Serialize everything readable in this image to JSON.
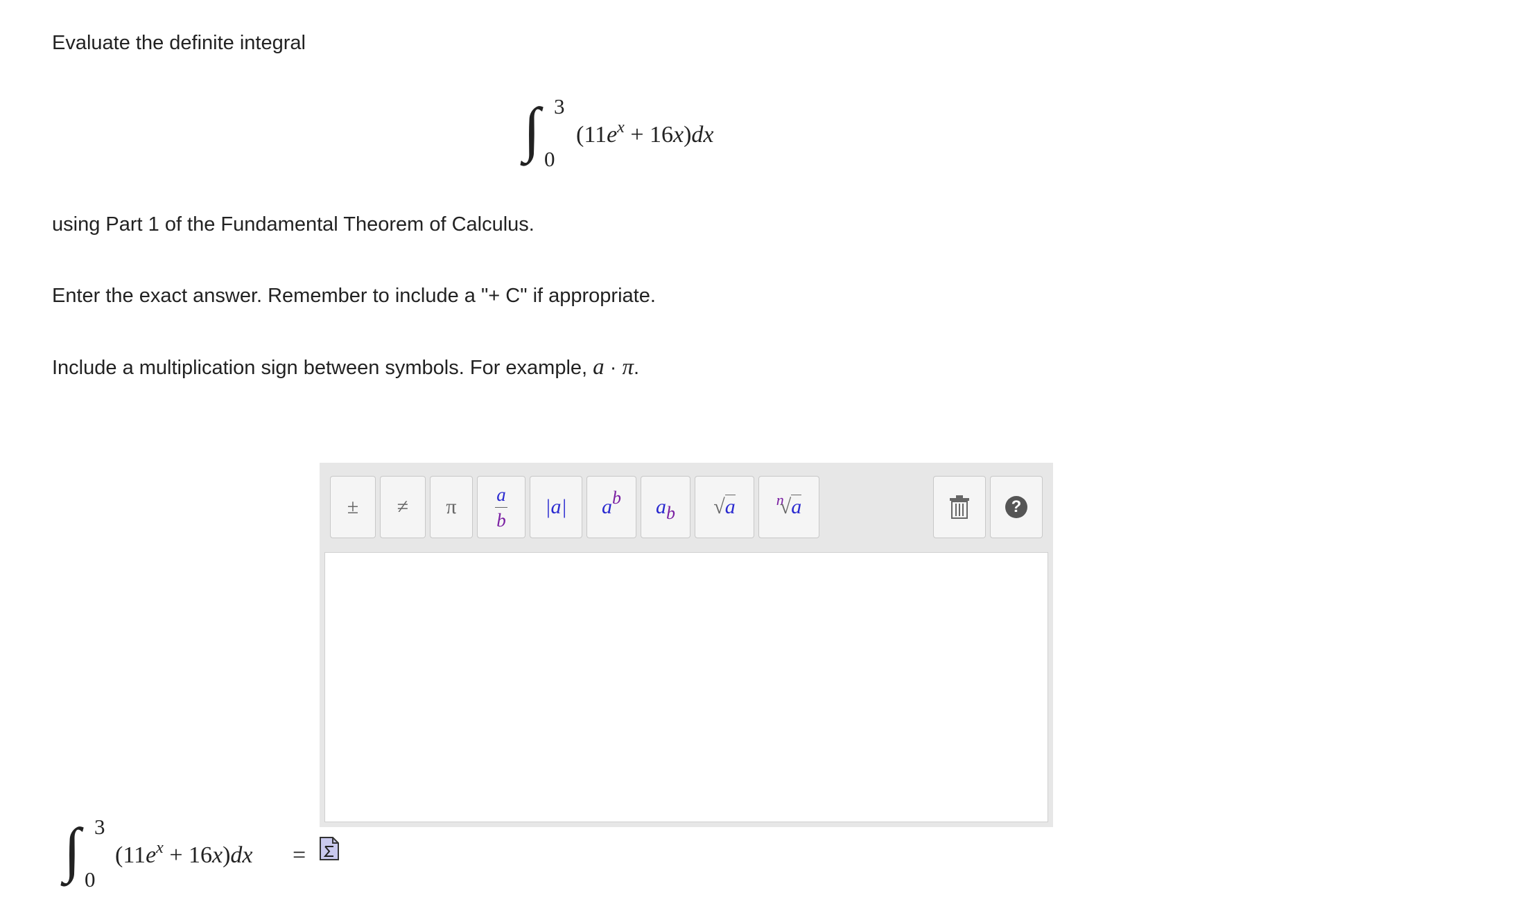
{
  "question": {
    "intro": "Evaluate the definite integral",
    "part_text": "using Part 1 of the Fundamental Theorem of Calculus.",
    "instruction_exact": "Enter the exact answer. Remember to include a \"+ C\" if appropriate.",
    "instruction_mult_prefix": "Include a multiplication sign between symbols. For example, ",
    "example_a": "a",
    "example_dot": " · ",
    "example_pi": "π",
    "example_end": "."
  },
  "integral": {
    "upper": "3",
    "lower": "0",
    "open_paren": "(11",
    "e": "e",
    "exp": "x",
    "plus_term": " + 16",
    "x": "x",
    "close_paren": ")",
    "dx": "dx",
    "equals": "="
  },
  "toolbar": {
    "plus_minus": "±",
    "not_equal": "≠",
    "pi": "π",
    "frac_num": "a",
    "frac_den": "b",
    "abs": "|a|",
    "pow_base": "a",
    "pow_exp": "b",
    "sub_base": "a",
    "sub_idx": "b",
    "sqrt_sign": "√",
    "sqrt_arg": "a",
    "nroot_n": "n",
    "nroot_sign": "√",
    "nroot_arg": "a",
    "help": "?"
  },
  "answer": {
    "value": ""
  },
  "colors": {
    "toolbar_bg": "#e7e7e7",
    "button_bg": "#f5f5f5",
    "math_blue": "#2a2ad0",
    "math_purple": "#7a1fa2"
  }
}
